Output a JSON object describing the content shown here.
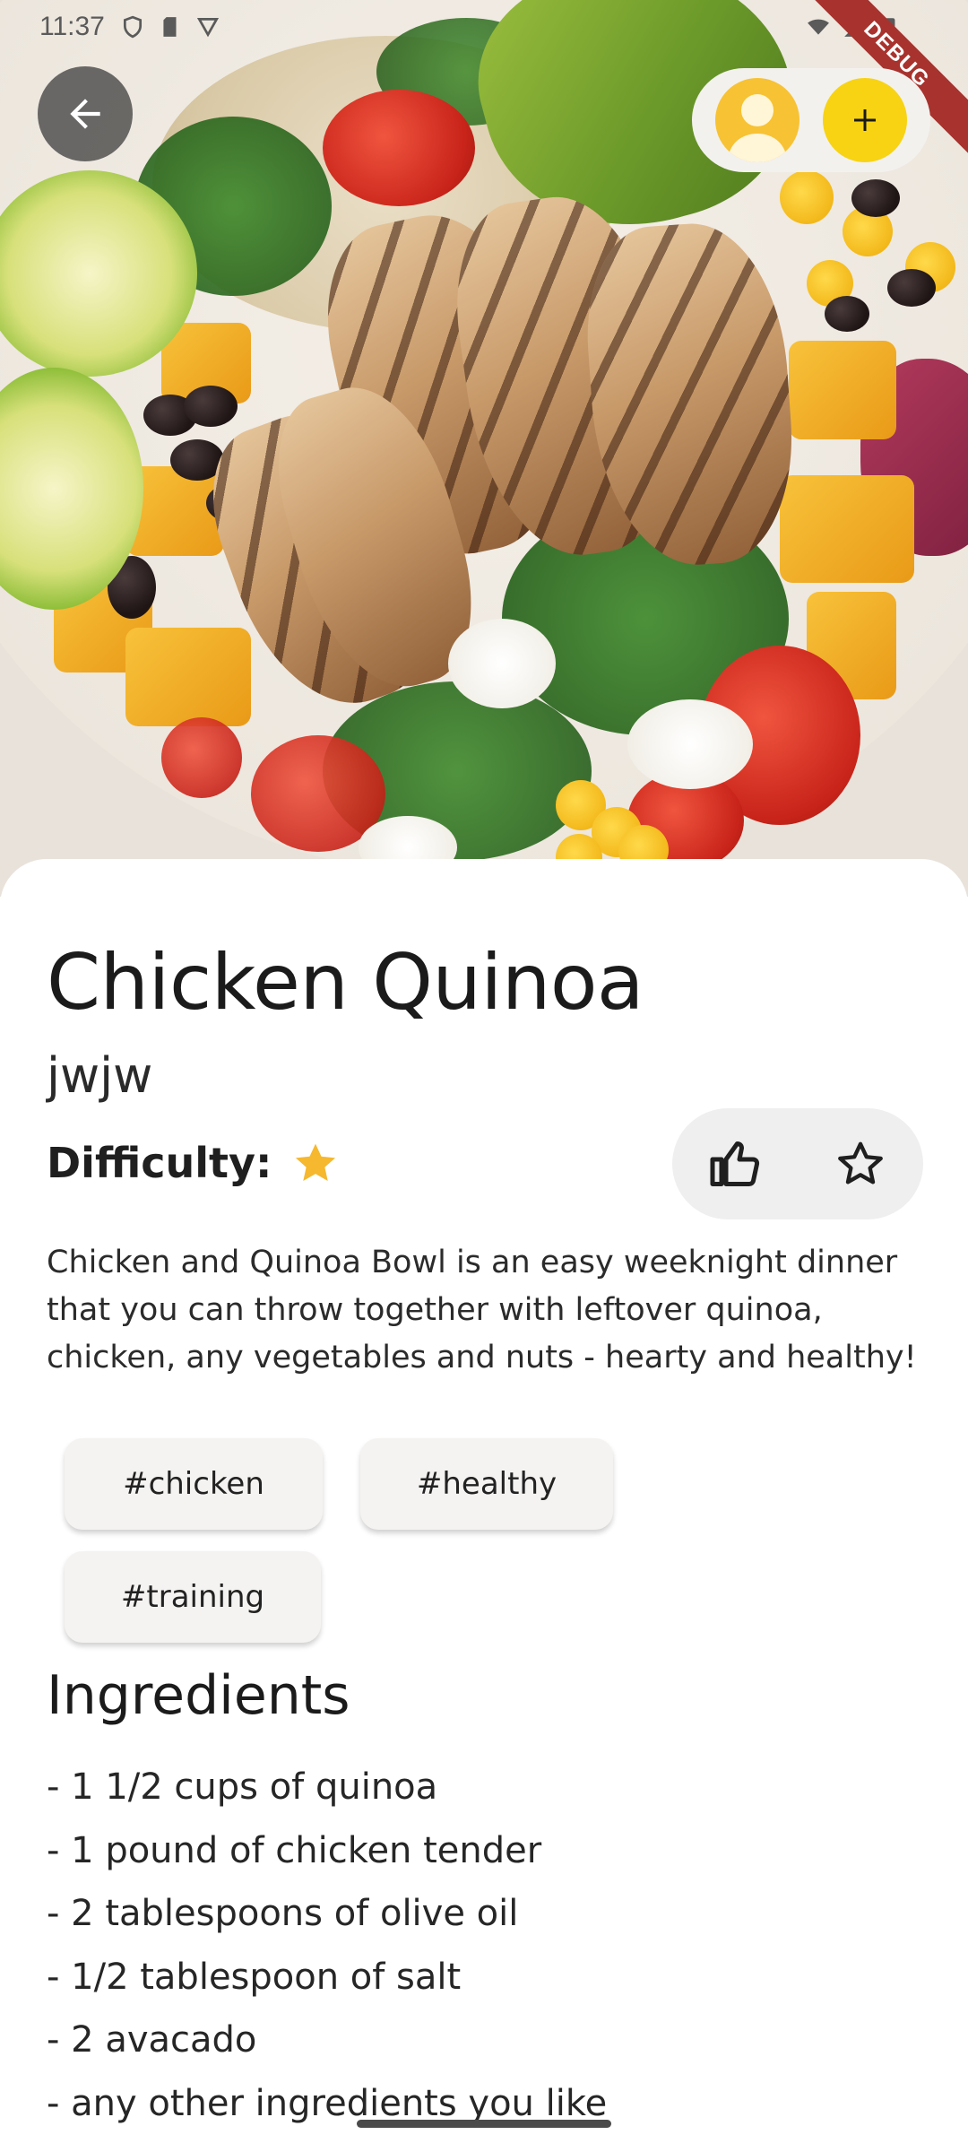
{
  "status_bar": {
    "time": "11:37",
    "debug_label": "DEBUG"
  },
  "hero": {
    "image_icon": "food-bowl-photo"
  },
  "recipe": {
    "title": "Chicken Quinoa",
    "author": "jwjw",
    "difficulty_label": "Difficulty:",
    "difficulty_stars": 1,
    "description": "Chicken and Quinoa Bowl is an easy weeknight dinner that you can throw together with leftover quinoa, chicken, any vegetables and nuts - hearty and healthy!",
    "tags": [
      "#chicken",
      "#healthy",
      "#training"
    ]
  },
  "ingredients": {
    "heading": "Ingredients",
    "items": [
      "- 1 1/2 cups of quinoa",
      "- 1 pound of chicken tender",
      "- 2 tablespoons of olive oil",
      "- 1/2 tablespoon of salt",
      "- 2 avacado",
      "- any other ingredients you like"
    ]
  },
  "colors": {
    "accent_yellow": "#f7d313",
    "avatar_yellow": "#f7c233",
    "star_color": "#f5b82e",
    "debug_ribbon": "#a8322d"
  }
}
